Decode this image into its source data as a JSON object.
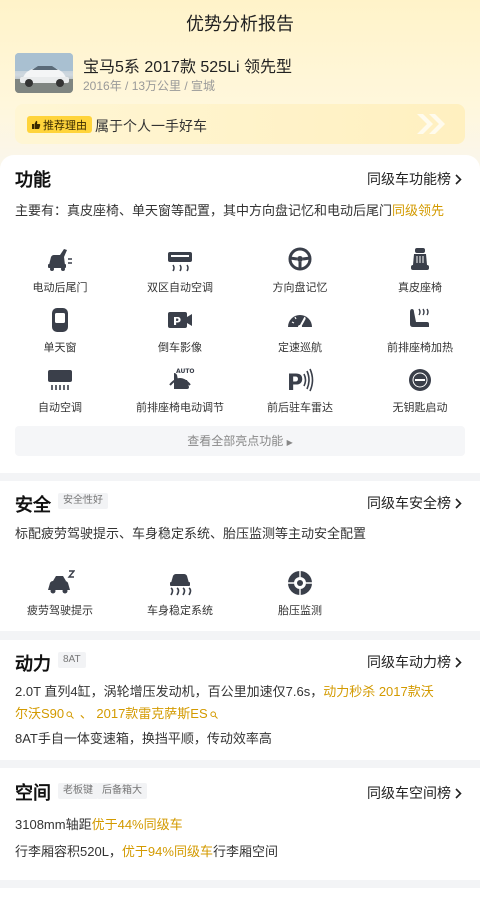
{
  "header": {
    "title": "优势分析报告"
  },
  "car": {
    "name": "宝马5系 2017款 525Li 领先型",
    "meta": "2016年 / 13万公里 / 宣城"
  },
  "reason": {
    "tag": "推荐理由",
    "text": "属于个人一手好车"
  },
  "function": {
    "title": "功能",
    "link": "同级车功能榜",
    "summary_prefix": "主要有：真皮座椅、单天窗等配置，其中方向盘记忆和电动后尾门",
    "summary_highlight": "同级领先",
    "items": [
      {
        "label": "电动后尾门",
        "icon": "car-tailgate-icon"
      },
      {
        "label": "双区自动空调",
        "icon": "dual-climate-icon"
      },
      {
        "label": "方向盘记忆",
        "icon": "steering-wheel-icon"
      },
      {
        "label": "真皮座椅",
        "icon": "leather-seat-icon"
      },
      {
        "label": "单天窗",
        "icon": "sunroof-icon"
      },
      {
        "label": "倒车影像",
        "icon": "parking-camera-icon"
      },
      {
        "label": "定速巡航",
        "icon": "cruise-control-icon"
      },
      {
        "label": "前排座椅加热",
        "icon": "seat-heating-icon"
      },
      {
        "label": "自动空调",
        "icon": "auto-ac-icon"
      },
      {
        "label": "前排座椅电动调节",
        "icon": "power-seat-icon"
      },
      {
        "label": "前后驻车雷达",
        "icon": "parking-radar-icon"
      },
      {
        "label": "无钥匙启动",
        "icon": "keyless-start-icon"
      }
    ],
    "more": "查看全部亮点功能"
  },
  "safety": {
    "title": "安全",
    "tag": "安全性好",
    "link": "同级车安全榜",
    "summary": "标配疲劳驾驶提示、车身稳定系统、胎压监测等主动安全配置",
    "items": [
      {
        "label": "疲劳驾驶提示",
        "icon": "fatigue-alert-icon"
      },
      {
        "label": "车身稳定系统",
        "icon": "stability-control-icon"
      },
      {
        "label": "胎压监测",
        "icon": "tire-pressure-icon"
      }
    ]
  },
  "power": {
    "title": "动力",
    "tag": "8AT",
    "link": "同级车动力榜",
    "line1_prefix": "2.0T 直列4缸，涡轮增压发动机，百公里加速仅7.6s，",
    "line1_highlight": "动力秒杀 2017款沃",
    "line2_highlight_a": "尔沃S90",
    "line2_sep": " 、 ",
    "line2_highlight_b": "2017款雷克萨斯ES",
    "line3": "8AT手自一体变速箱，换挡平顺，传动效率高"
  },
  "space": {
    "title": "空间",
    "tags": [
      "老板键",
      "后备箱大"
    ],
    "link": "同级车空间榜",
    "line1_prefix": "3108mm轴距",
    "line1_highlight": "优于44%同级车",
    "line2_prefix": "行李厢容积520L，",
    "line2_highlight": "优于94%同级车",
    "line2_suffix": "行李厢空间"
  },
  "colors": {
    "accent": "#d39a00",
    "tag_yellow": "#ffd43b",
    "icon_dark": "#3a3f4a"
  }
}
